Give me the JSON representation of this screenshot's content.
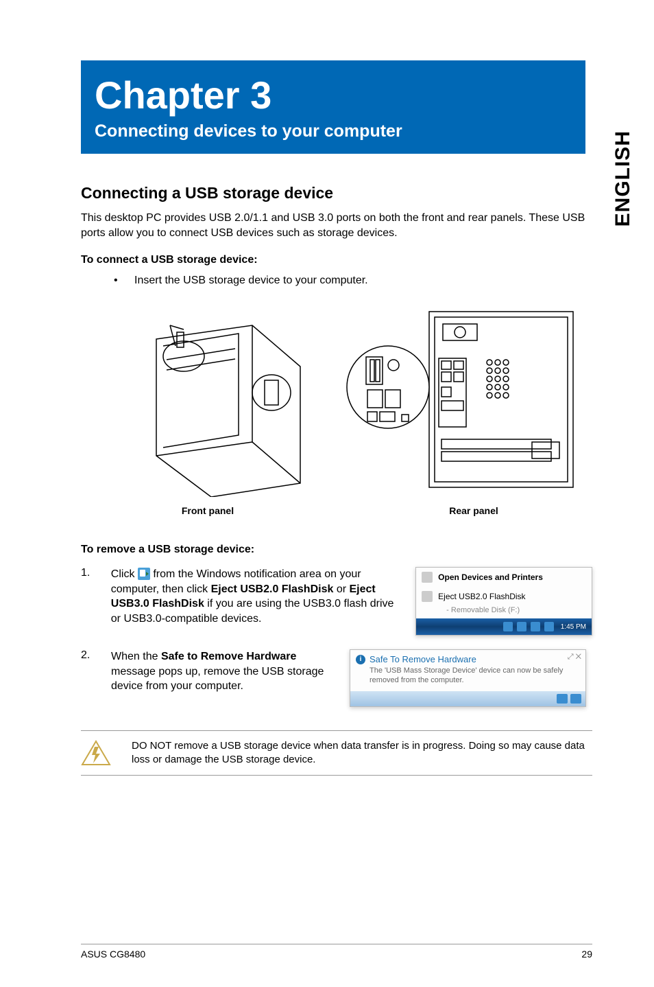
{
  "sideLabel": "ENGLISH",
  "chapter": {
    "title": "Chapter 3",
    "subtitle": "Connecting devices to your computer"
  },
  "section": {
    "heading": "Connecting a USB storage device",
    "intro": "This desktop PC provides USB 2.0/1.1 and USB 3.0 ports on both the front and rear panels. These USB ports allow you to connect USB devices such as storage devices.",
    "connectHeading": "To connect a USB storage device:",
    "connectBullet": "Insert the USB storage device to your computer.",
    "captionFront": "Front panel",
    "captionRear": "Rear panel",
    "removeHeading": "To remove a USB storage device:",
    "steps": [
      {
        "num": "1.",
        "pre": "Click ",
        "mid": " from the Windows notification area on your computer, then click ",
        "b1": "Eject USB2.0 FlashDisk",
        "mid2": " or ",
        "b2": "Eject USB3.0 FlashDisk",
        "post": " if you are using the USB3.0 flash drive or USB3.0-compatible devices."
      },
      {
        "num": "2.",
        "pre": "When the ",
        "b1": "Safe to Remove Hardware",
        "post": " message pops up, remove the USB storage device from your computer."
      }
    ],
    "warning": "DO NOT remove a USB storage device when data transfer is in progress. Doing so may cause data loss or damage the USB storage device."
  },
  "popup1": {
    "row1": "Open Devices and Printers",
    "row2": "Eject USB2.0 FlashDisk",
    "sub": "- Removable Disk (F:)",
    "time": "1:45 PM"
  },
  "popup2": {
    "title": "Safe To Remove Hardware",
    "body": "The 'USB Mass Storage Device' device can now be safely removed from the computer.",
    "close": "✕"
  },
  "footer": {
    "left": "ASUS CG8480",
    "right": "29"
  }
}
